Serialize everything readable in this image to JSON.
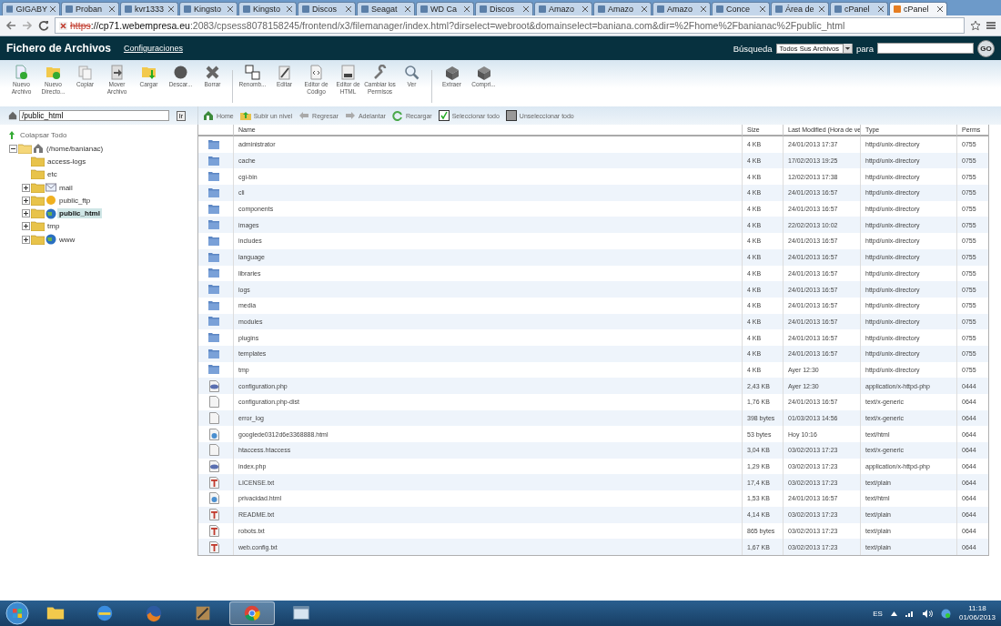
{
  "browser": {
    "tabs": [
      {
        "label": "GIGABY",
        "selected": false
      },
      {
        "label": "Proban",
        "selected": false
      },
      {
        "label": "kvr1333",
        "selected": false
      },
      {
        "label": "Kingsto",
        "selected": false
      },
      {
        "label": "Kingsto",
        "selected": false
      },
      {
        "label": "Discos",
        "selected": false
      },
      {
        "label": "Seagat",
        "selected": false
      },
      {
        "label": "WD Ca",
        "selected": false
      },
      {
        "label": "Discos",
        "selected": false
      },
      {
        "label": "Amazo",
        "selected": false
      },
      {
        "label": "Amazo",
        "selected": false
      },
      {
        "label": "Amazo",
        "selected": false
      },
      {
        "label": "Conce",
        "selected": false
      },
      {
        "label": "Área de",
        "selected": false
      },
      {
        "label": "cPanel",
        "selected": false
      },
      {
        "label": "cPanel",
        "selected": true
      }
    ],
    "url": {
      "scheme": "https",
      "host": "://cp71.webempresa.eu",
      "path": ":2083/cpsess8078158245/frontend/x3/filemanager/index.html?dirselect=webroot&domainselect=baniana.com&dir=%2Fhome%2Fbanianac%2Fpublic_html"
    }
  },
  "header": {
    "title": "Fichero de Archivos",
    "link": "Configuraciones",
    "search_label": "Búsqueda",
    "search_scope": "Todos Sus Archivos",
    "for_label": "para",
    "go": "GO"
  },
  "toolbar": {
    "groups": [
      [
        "Nuevo Archivo",
        "Nuevo Directo...",
        "Copiar",
        "Mover Archivo",
        "Cargar",
        "Descar...",
        "Borrar"
      ],
      [
        "Renomb...",
        "Editar",
        "Editor de Código",
        "Editor de HTML",
        "Cambiar los Permisos",
        "Ver"
      ],
      [
        "Extraer",
        "Compri..."
      ]
    ]
  },
  "path_field": {
    "value": "/public_html",
    "go": "Ir"
  },
  "nav": [
    "Home",
    "Subir un nivel",
    "Regresar",
    "Adelantar",
    "Recargar",
    "Seleccionar todo",
    "Unseleccionar todo"
  ],
  "tree": {
    "collapse_all": "Colapsar Todo",
    "root": {
      "label": "(/home/banianac)",
      "expanded": true,
      "selected": false,
      "children": [
        {
          "label": "access-logs",
          "selected": false
        },
        {
          "label": "etc",
          "selected": false
        },
        {
          "label": "mail",
          "expanded": false,
          "selected": false
        },
        {
          "label": "public_ftp",
          "expanded": false,
          "selected": false
        },
        {
          "label": "public_html",
          "expanded": false,
          "selected": true
        },
        {
          "label": "tmp",
          "expanded": false,
          "selected": false
        },
        {
          "label": "www",
          "expanded": false,
          "selected": false
        }
      ]
    }
  },
  "table": {
    "columns": [
      "Name",
      "Size",
      "Last Modified (Hora de ve",
      "Type",
      "Perms"
    ],
    "rows": [
      {
        "kind": "folder",
        "name": "administrator",
        "size": "4 KB",
        "modified": "24/01/2013 17:37",
        "type": "httpd/unix-directory",
        "perms": "0755"
      },
      {
        "kind": "folder",
        "name": "cache",
        "size": "4 KB",
        "modified": "17/02/2013 19:25",
        "type": "httpd/unix-directory",
        "perms": "0755"
      },
      {
        "kind": "folder",
        "name": "cgi-bin",
        "size": "4 KB",
        "modified": "12/02/2013 17:38",
        "type": "httpd/unix-directory",
        "perms": "0755"
      },
      {
        "kind": "folder",
        "name": "cli",
        "size": "4 KB",
        "modified": "24/01/2013 16:57",
        "type": "httpd/unix-directory",
        "perms": "0755"
      },
      {
        "kind": "folder",
        "name": "components",
        "size": "4 KB",
        "modified": "24/01/2013 16:57",
        "type": "httpd/unix-directory",
        "perms": "0755"
      },
      {
        "kind": "folder",
        "name": "images",
        "size": "4 KB",
        "modified": "22/02/2013 10:02",
        "type": "httpd/unix-directory",
        "perms": "0755"
      },
      {
        "kind": "folder",
        "name": "includes",
        "size": "4 KB",
        "modified": "24/01/2013 16:57",
        "type": "httpd/unix-directory",
        "perms": "0755"
      },
      {
        "kind": "folder",
        "name": "language",
        "size": "4 KB",
        "modified": "24/01/2013 16:57",
        "type": "httpd/unix-directory",
        "perms": "0755"
      },
      {
        "kind": "folder",
        "name": "libraries",
        "size": "4 KB",
        "modified": "24/01/2013 16:57",
        "type": "httpd/unix-directory",
        "perms": "0755"
      },
      {
        "kind": "folder",
        "name": "logs",
        "size": "4 KB",
        "modified": "24/01/2013 16:57",
        "type": "httpd/unix-directory",
        "perms": "0755"
      },
      {
        "kind": "folder",
        "name": "media",
        "size": "4 KB",
        "modified": "24/01/2013 16:57",
        "type": "httpd/unix-directory",
        "perms": "0755"
      },
      {
        "kind": "folder",
        "name": "modules",
        "size": "4 KB",
        "modified": "24/01/2013 16:57",
        "type": "httpd/unix-directory",
        "perms": "0755"
      },
      {
        "kind": "folder",
        "name": "plugins",
        "size": "4 KB",
        "modified": "24/01/2013 16:57",
        "type": "httpd/unix-directory",
        "perms": "0755"
      },
      {
        "kind": "folder",
        "name": "templates",
        "size": "4 KB",
        "modified": "24/01/2013 16:57",
        "type": "httpd/unix-directory",
        "perms": "0755"
      },
      {
        "kind": "folder",
        "name": "tmp",
        "size": "4 KB",
        "modified": "Ayer 12:30",
        "type": "httpd/unix-directory",
        "perms": "0755"
      },
      {
        "kind": "php",
        "name": "configuration.php",
        "size": "2,43 KB",
        "modified": "Ayer 12:30",
        "type": "application/x-httpd-php",
        "perms": "0444"
      },
      {
        "kind": "file",
        "name": "configuration.php-dist",
        "size": "1,76 KB",
        "modified": "24/01/2013 16:57",
        "type": "text/x-generic",
        "perms": "0644"
      },
      {
        "kind": "file",
        "name": "error_log",
        "size": "398 bytes",
        "modified": "01/03/2013 14:56",
        "type": "text/x-generic",
        "perms": "0644"
      },
      {
        "kind": "html",
        "name": "googlede0312d6e3368888.html",
        "size": "53 bytes",
        "modified": "Hoy 10:16",
        "type": "text/html",
        "perms": "0644"
      },
      {
        "kind": "file",
        "name": "htaccess.htaccess",
        "size": "3,04 KB",
        "modified": "03/02/2013 17:23",
        "type": "text/x-generic",
        "perms": "0644"
      },
      {
        "kind": "php",
        "name": "index.php",
        "size": "1,29 KB",
        "modified": "03/02/2013 17:23",
        "type": "application/x-httpd-php",
        "perms": "0644"
      },
      {
        "kind": "text",
        "name": "LICENSE.txt",
        "size": "17,4 KB",
        "modified": "03/02/2013 17:23",
        "type": "text/plain",
        "perms": "0644"
      },
      {
        "kind": "html",
        "name": "privacidad.html",
        "size": "1,53 KB",
        "modified": "24/01/2013 16:57",
        "type": "text/html",
        "perms": "0644"
      },
      {
        "kind": "text",
        "name": "README.txt",
        "size": "4,14 KB",
        "modified": "03/02/2013 17:23",
        "type": "text/plain",
        "perms": "0644"
      },
      {
        "kind": "text",
        "name": "robots.txt",
        "size": "865 bytes",
        "modified": "03/02/2013 17:23",
        "type": "text/plain",
        "perms": "0644"
      },
      {
        "kind": "text",
        "name": "web.config.txt",
        "size": "1,67 KB",
        "modified": "03/02/2013 17:23",
        "type": "text/plain",
        "perms": "0644"
      }
    ]
  },
  "taskbar": {
    "apps": [
      {
        "selected": false
      },
      {
        "selected": false
      },
      {
        "selected": false
      },
      {
        "selected": false
      },
      {
        "selected": true
      },
      {
        "selected": false
      }
    ],
    "language": "ES",
    "time": "11:18",
    "date": "01/06/2013"
  }
}
